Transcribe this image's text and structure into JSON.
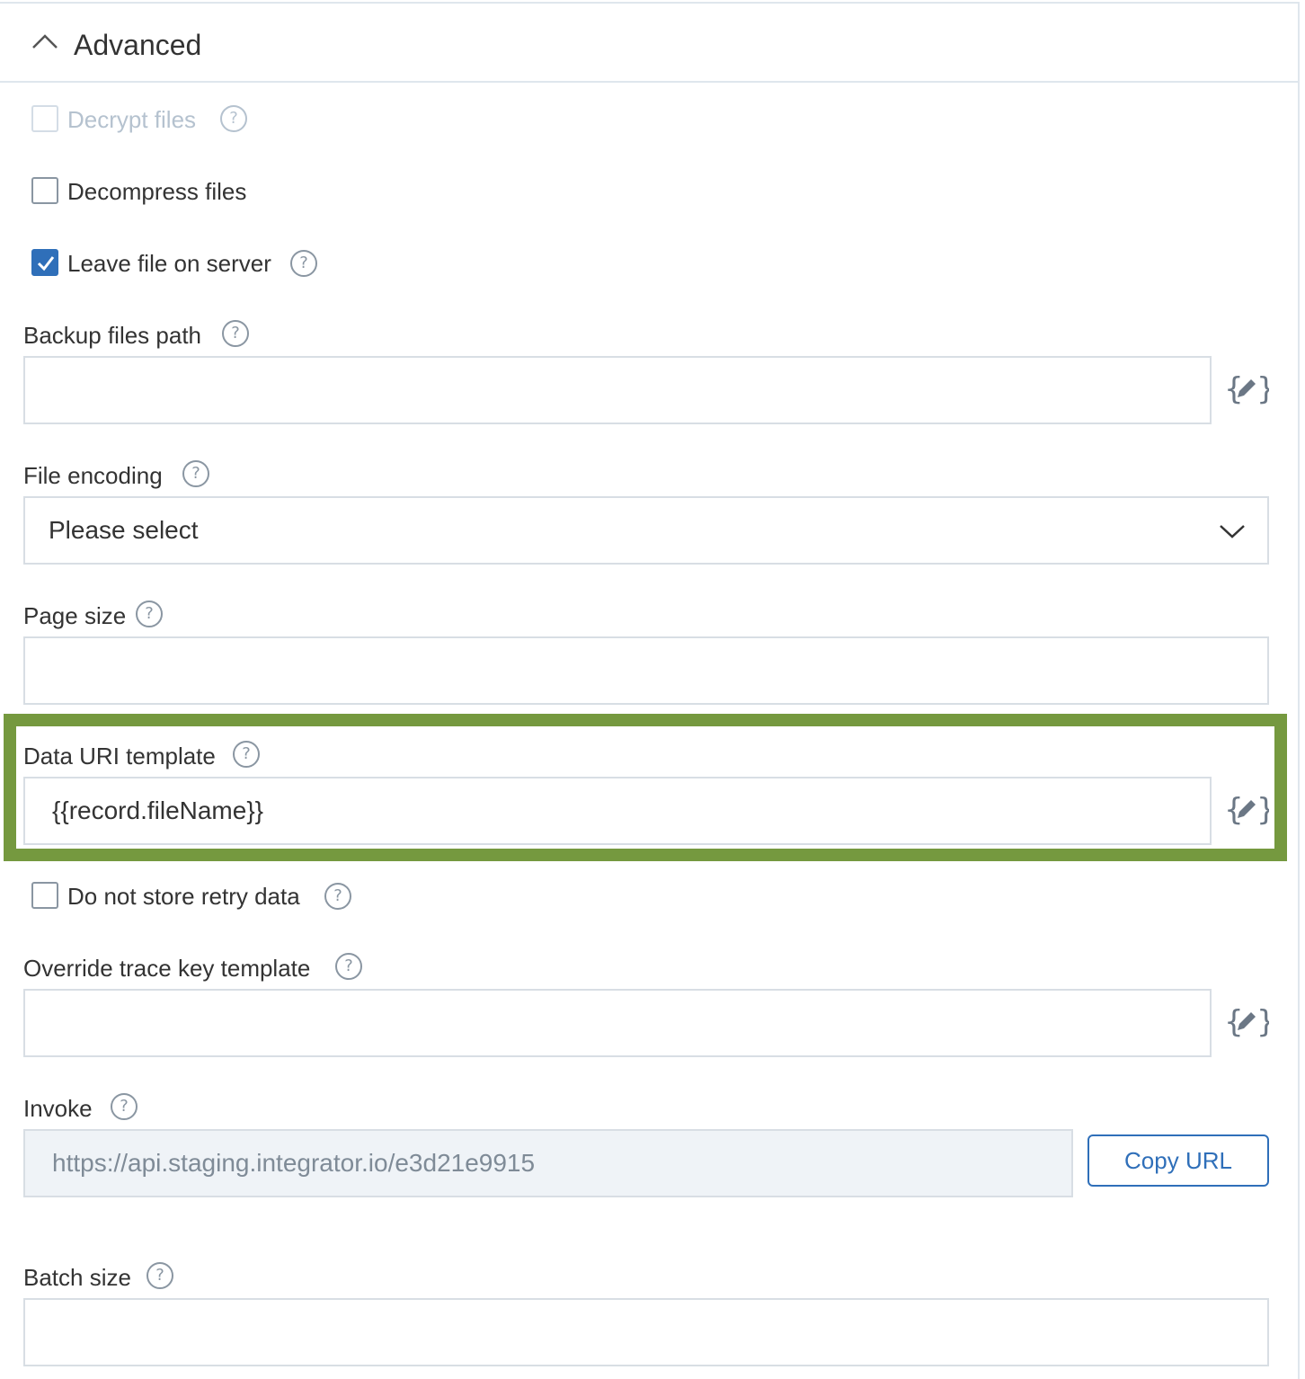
{
  "section": {
    "title": "Advanced"
  },
  "checkboxes": {
    "decrypt": {
      "label": "Decrypt files",
      "checked": false,
      "disabled": true
    },
    "decompress": {
      "label": "Decompress files",
      "checked": false
    },
    "leave_on_server": {
      "label": "Leave file on server",
      "checked": true
    },
    "no_retry": {
      "label": "Do not store retry data",
      "checked": false
    }
  },
  "fields": {
    "backup_path": {
      "label": "Backup files path",
      "value": ""
    },
    "file_encoding": {
      "label": "File encoding",
      "value": "Please select"
    },
    "page_size": {
      "label": "Page size",
      "value": ""
    },
    "data_uri": {
      "label": "Data URI template",
      "value": "{{record.fileName}}"
    },
    "trace_key": {
      "label": "Override trace key template",
      "value": ""
    },
    "invoke": {
      "label": "Invoke",
      "value": "https://api.staging.integrator.io/e3d21e9915",
      "button": "Copy URL"
    },
    "batch_size": {
      "label": "Batch size",
      "value": ""
    }
  },
  "icons": {
    "help": "?",
    "help_icon": "question-circle-icon",
    "handlebars_icon": "handlebars-edit-icon",
    "collapse_icon": "chevron-up-icon",
    "dropdown_icon": "chevron-down-icon"
  },
  "colors": {
    "accent": "#2f6fb9",
    "highlight": "#75993f",
    "border": "#d8dee4",
    "readonly_bg": "#eff3f7"
  }
}
